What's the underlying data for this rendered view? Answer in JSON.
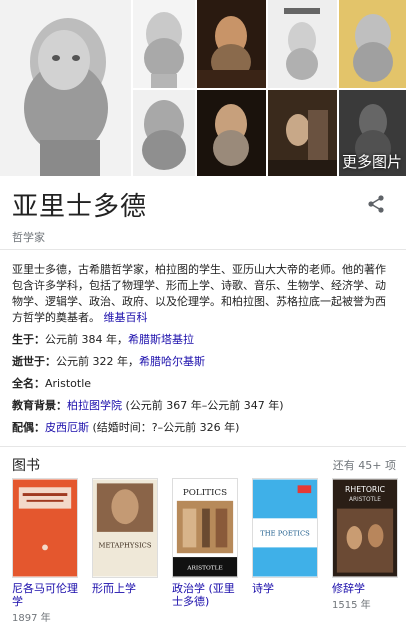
{
  "gallery": {
    "more_label": "更多图片"
  },
  "entity": {
    "title": "亚里士多德",
    "subtitle": "哲学家"
  },
  "description": {
    "text": "亚里士多德，古希腊哲学家，柏拉图的学生、亚历山大大帝的老师。他的著作包含许多学科，包括了物理学、形而上学、诗歌、音乐、生物学、经济学、动物学、逻辑学、政治、政府、以及伦理学。和柏拉图、苏格拉底一起被誉为西方哲学的奠基者。",
    "source": "维基百科"
  },
  "facts": [
    {
      "label": "生于：",
      "value": "公元前 384 年，",
      "link": "希腊斯塔基拉",
      "suffix": ""
    },
    {
      "label": "逝世于：",
      "value": "公元前 322 年，",
      "link": "希腊哈尔基斯",
      "suffix": ""
    },
    {
      "label": "全名：",
      "value": "Aristotle",
      "link": "",
      "suffix": ""
    },
    {
      "label": "教育背景：",
      "value": "",
      "link": "柏拉图学院",
      "suffix": " (公元前 367 年–公元前 347 年)"
    },
    {
      "label": "配偶：",
      "value": "",
      "link": "皮西厄斯",
      "suffix": " (结婚时间：?–公元前 326 年)"
    }
  ],
  "books": {
    "title": "图书",
    "more": "还有 45+ 项",
    "items": [
      {
        "title": "尼各马可伦理学",
        "year": "1897 年"
      },
      {
        "title": "形而上学",
        "year": ""
      },
      {
        "title": "政治学 (亚里士多德)",
        "year": ""
      },
      {
        "title": "诗学",
        "year": ""
      },
      {
        "title": "修辞学",
        "year": "1515 年"
      }
    ],
    "covers": {
      "metaphysics": "METAPHYSICS",
      "politics": "POLITICS",
      "politics_author": "ARISTOTLE",
      "poetics": "THE POETICS",
      "rhetoric": "RHETORIC",
      "rhetoric_author": "ARISTOTLE"
    }
  }
}
